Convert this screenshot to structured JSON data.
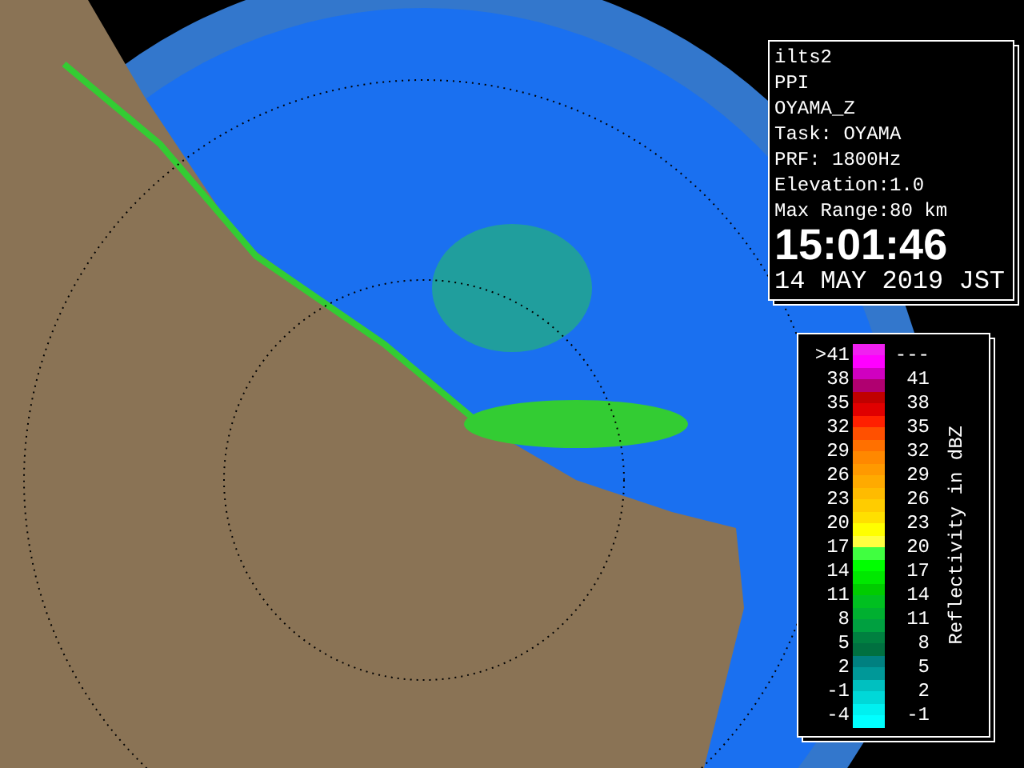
{
  "info_panel": {
    "lines": [
      "ilts2",
      "PPI",
      "OYAMA_Z",
      "Task: OYAMA",
      "PRF: 1800Hz",
      "Elevation:1.0",
      "Max Range:80 km"
    ],
    "time": "15:01:46",
    "date": "14 MAY 2019 JST"
  },
  "legend": {
    "title": "Reflectivity in dBZ",
    "rows": [
      {
        "low": ">41",
        "high": "---"
      },
      {
        "low": "38",
        "high": "41"
      },
      {
        "low": "35",
        "high": "38"
      },
      {
        "low": "32",
        "high": "35"
      },
      {
        "low": "29",
        "high": "32"
      },
      {
        "low": "26",
        "high": "29"
      },
      {
        "low": "23",
        "high": "26"
      },
      {
        "low": "20",
        "high": "23"
      },
      {
        "low": "17",
        "high": "20"
      },
      {
        "low": "14",
        "high": "17"
      },
      {
        "low": "11",
        "high": "14"
      },
      {
        "low": "8",
        "high": "11"
      },
      {
        "low": "5",
        "high": "8"
      },
      {
        "low": "2",
        "high": "5"
      },
      {
        "low": "-1",
        "high": "2"
      },
      {
        "low": "-4",
        "high": "-1"
      }
    ],
    "stripes": [
      {
        "color": "#f020f0"
      },
      {
        "color": "#ff00ff"
      },
      {
        "color": "#d000c0"
      },
      {
        "color": "#b00070"
      },
      {
        "color": "#c00000"
      },
      {
        "color": "#e00000"
      },
      {
        "color": "#ff2000"
      },
      {
        "color": "#ff5000"
      },
      {
        "color": "#ff7000"
      },
      {
        "color": "#ff8800"
      },
      {
        "color": "#ff9900"
      },
      {
        "color": "#ffaa00"
      },
      {
        "color": "#ffbb00"
      },
      {
        "color": "#ffcc00"
      },
      {
        "color": "#ffe000"
      },
      {
        "color": "#ffff00"
      },
      {
        "color": "#ffff40"
      },
      {
        "color": "#40ff40"
      },
      {
        "color": "#00ff00"
      },
      {
        "color": "#00e800"
      },
      {
        "color": "#00cc00"
      },
      {
        "color": "#00c020"
      },
      {
        "color": "#00b030"
      },
      {
        "color": "#00a040"
      },
      {
        "color": "#008040"
      },
      {
        "color": "#007040"
      },
      {
        "color": "#008080"
      },
      {
        "color": "#009898"
      },
      {
        "color": "#00c0c0"
      },
      {
        "color": "#00d8d8"
      },
      {
        "color": "#00f0f0"
      },
      {
        "color": "#00ffff"
      }
    ]
  }
}
